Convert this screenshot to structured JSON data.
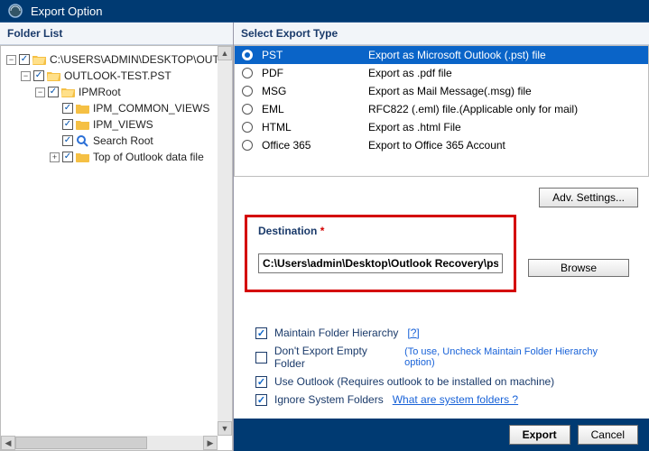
{
  "title": "Export Option",
  "left_header": "Folder List",
  "right_header": "Select Export Type",
  "tree": {
    "root": {
      "exp": "−",
      "label": "C:\\USERS\\ADMIN\\DESKTOP\\OUTL"
    },
    "n1": {
      "exp": "−",
      "label": "OUTLOOK-TEST.PST"
    },
    "n2": {
      "exp": "−",
      "label": "IPMRoot"
    },
    "n2a": {
      "exp": "",
      "label": "IPM_COMMON_VIEWS"
    },
    "n2b": {
      "exp": "",
      "label": "IPM_VIEWS"
    },
    "n2c": {
      "exp": "",
      "label": "Search Root"
    },
    "n2d": {
      "exp": "+",
      "label": "Top of Outlook data file"
    }
  },
  "types": [
    {
      "name": "PST",
      "desc": "Export as Microsoft Outlook (.pst) file"
    },
    {
      "name": "PDF",
      "desc": "Export as .pdf file"
    },
    {
      "name": "MSG",
      "desc": "Export as Mail Message(.msg) file"
    },
    {
      "name": "EML",
      "desc": "RFC822 (.eml) file.(Applicable only for mail)"
    },
    {
      "name": "HTML",
      "desc": "Export as .html File"
    },
    {
      "name": "Office 365",
      "desc": "Export to Office 365 Account"
    }
  ],
  "adv_btn": "Adv. Settings...",
  "destination": {
    "label": "Destination",
    "value": "C:\\Users\\admin\\Desktop\\Outlook Recovery\\pst",
    "browse": "Browse"
  },
  "opts": {
    "o1": {
      "label": "Maintain Folder Hierarchy",
      "help": "[?]"
    },
    "o2": {
      "label": "Don't Export Empty Folder",
      "hint": "(To use, Uncheck Maintain Folder Hierarchy option)"
    },
    "o3": {
      "label": "Use Outlook (Requires outlook to be installed on machine)"
    },
    "o4": {
      "label": "Ignore System Folders",
      "help": "What are system folders ?"
    }
  },
  "footer": {
    "export": "Export",
    "cancel": "Cancel"
  }
}
